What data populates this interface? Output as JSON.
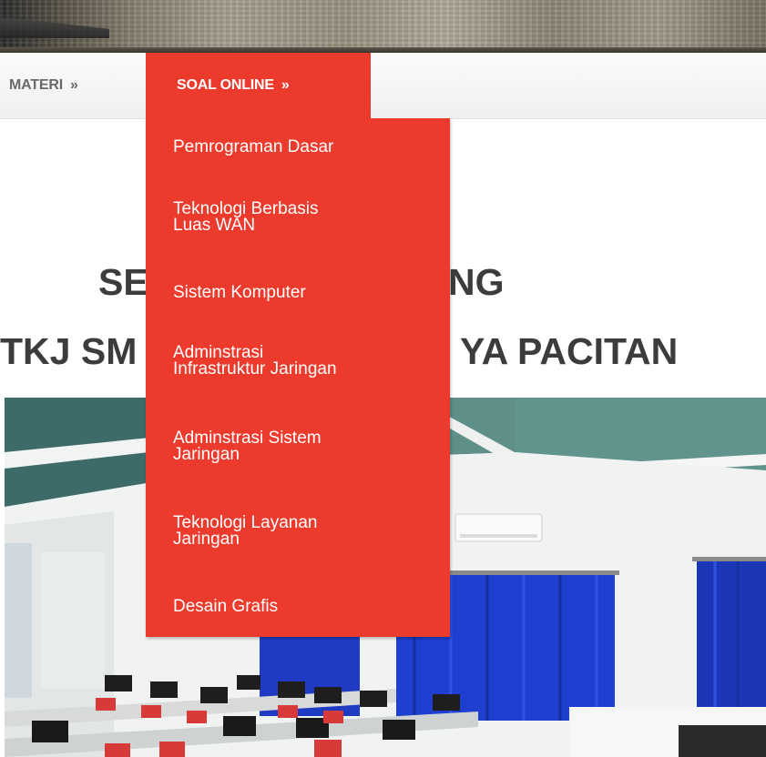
{
  "nav": {
    "items": [
      {
        "label": "MATERI",
        "arrow": "»"
      },
      {
        "label": "SOAL ONLINE",
        "arrow": "»"
      }
    ]
  },
  "dropdown": {
    "items": [
      {
        "line1": "Pemrograman Dasar",
        "line2": ""
      },
      {
        "line1": "Teknologi Berbasis",
        "line2": "Luas WAN"
      },
      {
        "line1": "Sistem Komputer",
        "line2": ""
      },
      {
        "line1": "Adminstrasi",
        "line2": "Infrastruktur Jaringan"
      },
      {
        "line1": "Adminstrasi Sistem",
        "line2": "Jaringan"
      },
      {
        "line1": "Teknologi Layanan",
        "line2": "Jaringan"
      },
      {
        "line1": "Desain Grafis",
        "line2": ""
      }
    ]
  },
  "heading": {
    "line1_left": "SE",
    "line1_right": "NG",
    "line2_left": "TKJ SM",
    "line2_right": "YA PACITAN"
  },
  "colors": {
    "accent": "#ec3a2c",
    "heading": "#3c3c3c",
    "nav_text": "#6a6a6a"
  }
}
